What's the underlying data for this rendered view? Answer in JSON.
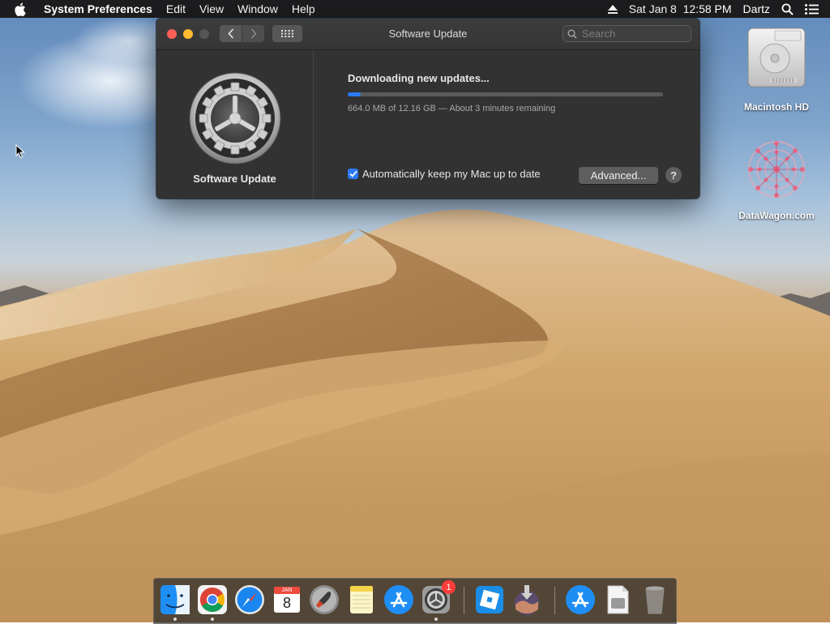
{
  "menubar": {
    "app_name": "System Preferences",
    "menus": [
      "Edit",
      "View",
      "Window",
      "Help"
    ],
    "clock": "Sat Jan 8  12:58 PM",
    "user": "Dartz"
  },
  "window": {
    "title": "Software Update",
    "search_placeholder": "Search",
    "pane_label": "Software Update",
    "status": "Downloading new updates...",
    "progress_fraction": 0.04,
    "progress_text": "664.0 MB of 12.16 GB — About 3 minutes remaining",
    "auto_update_label": "Automatically keep my Mac up to date",
    "auto_update_checked": true,
    "advanced_label": "Advanced...",
    "help_label": "?"
  },
  "desktop_icons": [
    {
      "label": "Macintosh HD",
      "icon": "hard-drive-icon"
    },
    {
      "label": "DataWagon.com",
      "icon": "datawagon-icon"
    }
  ],
  "dock": {
    "items": [
      {
        "name": "finder",
        "icon": "finder-icon",
        "running": true
      },
      {
        "name": "chrome",
        "icon": "chrome-icon",
        "running": true
      },
      {
        "name": "safari",
        "icon": "safari-icon",
        "running": false
      },
      {
        "name": "calendar",
        "icon": "calendar-icon",
        "running": false,
        "month": "JAN",
        "day": "8"
      },
      {
        "name": "launchpad",
        "icon": "launchpad-icon",
        "running": false
      },
      {
        "name": "notes",
        "icon": "notes-icon",
        "running": false
      },
      {
        "name": "app-store",
        "icon": "app-store-icon",
        "running": false
      },
      {
        "name": "system-preferences",
        "icon": "system-preferences-icon",
        "running": true,
        "badge": "1"
      },
      {
        "name": "roblox",
        "icon": "roblox-icon",
        "running": false
      },
      {
        "name": "macos-installer",
        "icon": "macos-installer-icon",
        "running": false
      },
      {
        "name": "app-store-folder",
        "icon": "app-store-icon",
        "running": false
      },
      {
        "name": "document",
        "icon": "document-icon",
        "running": false
      },
      {
        "name": "trash",
        "icon": "trash-icon",
        "running": false
      }
    ]
  },
  "colors": {
    "accent": "#2a7cf5",
    "window_bg": "#323232",
    "menubar_bg": "#1d1d1f"
  }
}
